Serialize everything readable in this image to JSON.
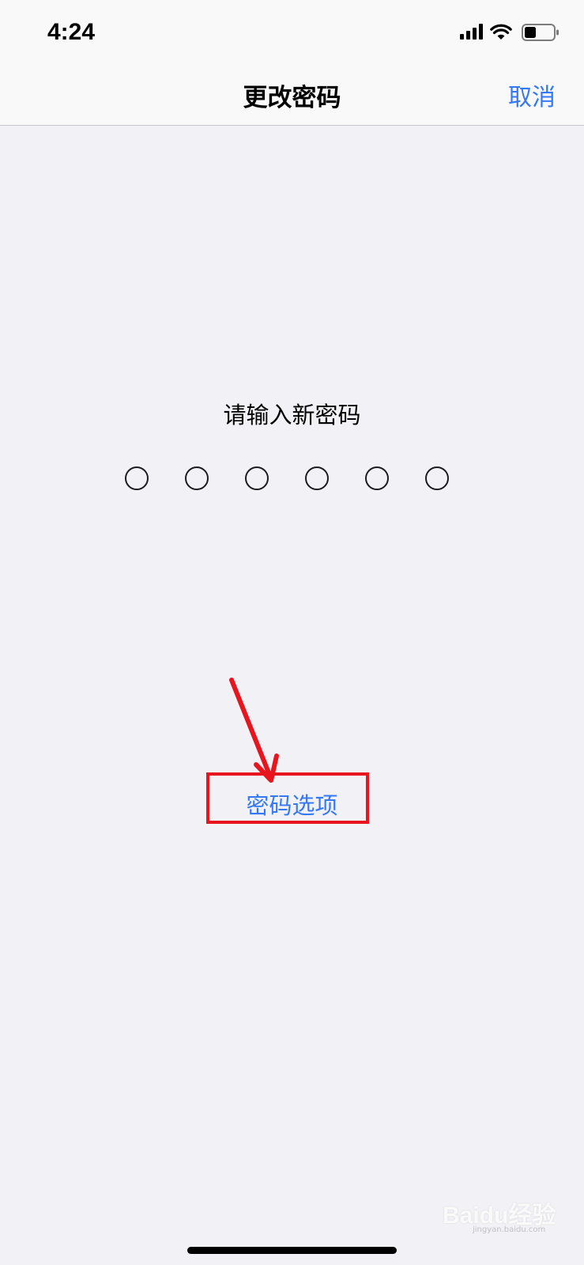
{
  "status_bar": {
    "time": "4:24",
    "icons": [
      "signal-icon",
      "wifi-icon",
      "battery-icon"
    ]
  },
  "nav": {
    "title": "更改密码",
    "cancel_label": "取消"
  },
  "passcode": {
    "prompt": "请输入新密码",
    "digit_count": 6,
    "entered_count": 0
  },
  "options_label": "密码选项",
  "annotation": {
    "highlight_color": "#e8151f",
    "arrow_color": "#e8151f"
  },
  "watermark": {
    "logo_text": "Baidu经验",
    "url_text": "jingyan.baidu.com"
  },
  "colors": {
    "accent": "#3478f6",
    "background": "#f2f1f6",
    "bar_background": "#f9f9f9"
  }
}
